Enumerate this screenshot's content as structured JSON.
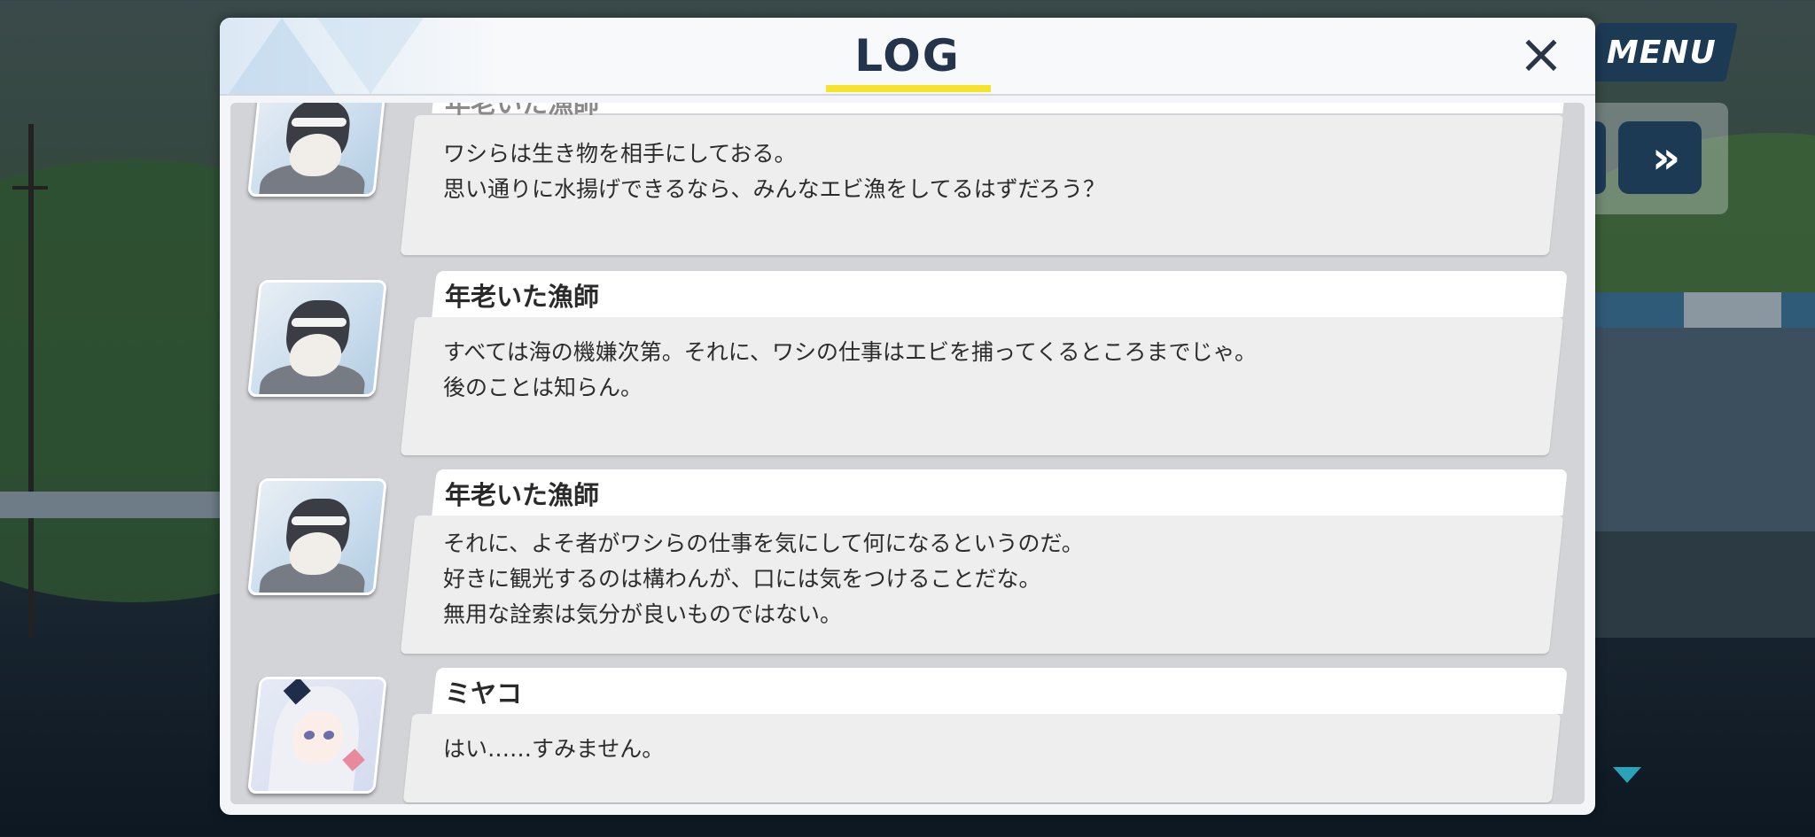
{
  "header": {
    "title": "LOG",
    "close_icon": "×"
  },
  "menu": {
    "label": "MENU",
    "fast_forward_icon": "»"
  },
  "log": {
    "entries": [
      {
        "speaker": "年老いた漁師",
        "avatar": "old-fisherman-avatar",
        "lines": "ワシらは生き物を相手にしておる。\n思い通りに水揚げできるなら、みんなエビ漁をしてるはずだろう？"
      },
      {
        "speaker": "年老いた漁師",
        "avatar": "old-fisherman-avatar",
        "lines": "すべては海の機嫌次第。それに、ワシの仕事はエビを捕ってくるところまでじゃ。\n後のことは知らん。"
      },
      {
        "speaker": "年老いた漁師",
        "avatar": "old-fisherman-avatar",
        "lines": "それに、よそ者がワシらの仕事を気にして何になるというのだ。\n好きに観光するのは構わんが、口には気をつけることだな。\n無用な詮索は気分が良いものではない。"
      },
      {
        "speaker": "ミヤコ",
        "avatar": "miyako-avatar",
        "lines": "はい……すみません。"
      }
    ]
  },
  "colors": {
    "accent_underline": "#f7e22c",
    "title_color": "#24344d",
    "menu_bg": "#1d3a55",
    "scroll_indicator": "#2aa3b8"
  }
}
